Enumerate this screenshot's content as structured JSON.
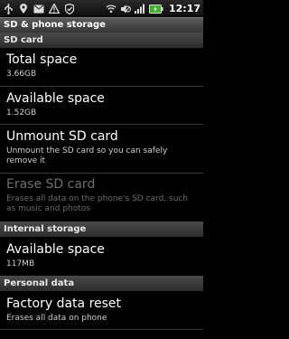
{
  "status_bar": {
    "time": "12:17",
    "icons": [
      "usb-icon",
      "location-icon",
      "gmail-icon",
      "warning-icon",
      "shield-icon",
      "wifi-icon",
      "mute-icon",
      "signal-icon",
      "battery-icon"
    ]
  },
  "screen_title": "SD & phone storage",
  "sd_card": {
    "header": "SD card",
    "total_space": {
      "title": "Total space",
      "value": "3.66GB"
    },
    "available_space": {
      "title": "Available space",
      "value": "1.52GB"
    },
    "unmount": {
      "title": "Unmount SD card",
      "summary": "Unmount the SD card so you can safely remove it"
    },
    "erase": {
      "title": "Erase SD card",
      "summary": "Erases all data on the phone's SD card, such as music and photos",
      "enabled": false
    }
  },
  "internal_storage": {
    "header": "Internal storage",
    "available_space": {
      "title": "Available space",
      "value": "117MB"
    }
  },
  "personal_data": {
    "header": "Personal data",
    "factory_reset": {
      "title": "Factory data reset",
      "summary": "Erases all data on phone"
    }
  },
  "colors": {
    "background": "#000000",
    "header_bg": "#3a3a3a",
    "disabled_text": "#6e6e6e"
  }
}
